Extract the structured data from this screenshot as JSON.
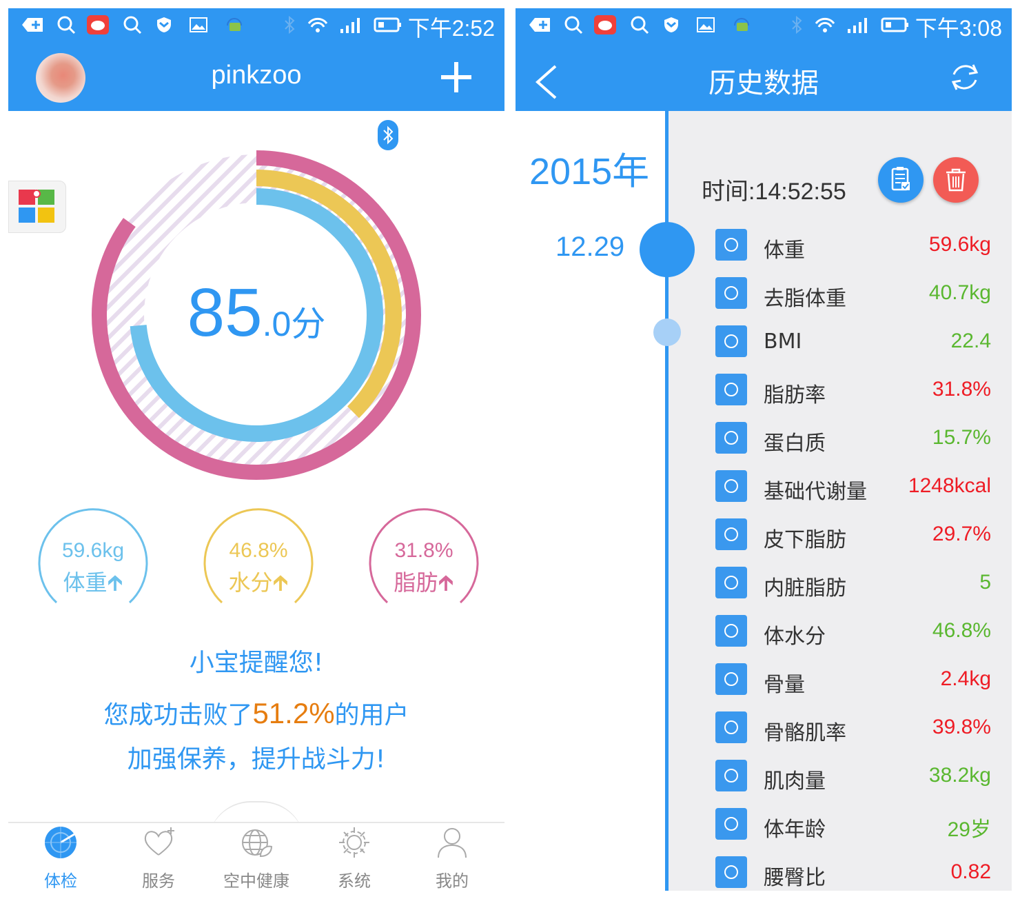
{
  "left": {
    "status_time": "下午2:52",
    "title": "pinkzoo",
    "score_int": "85",
    "score_dec": ".0分",
    "gauges": [
      {
        "value": "59.6kg",
        "label": "体重",
        "color": "#6cc1ec"
      },
      {
        "value": "46.8%",
        "label": "水分",
        "color": "#ecc755"
      },
      {
        "value": "31.8%",
        "label": "脂肪",
        "color": "#d6689a"
      }
    ],
    "reminder_title": "小宝提醒您!",
    "reminder_pre": "您成功击败了",
    "reminder_pct": "51.2%",
    "reminder_post": "的用户",
    "reminder_line2": "加强保养，提升战斗力!",
    "tabs": [
      {
        "label": "体检",
        "icon": "radar-icon"
      },
      {
        "label": "服务",
        "icon": "heart-plus-icon"
      },
      {
        "label": "空中健康",
        "icon": "globe-leaf-icon"
      },
      {
        "label": "系统",
        "icon": "gear-icon"
      },
      {
        "label": "我的",
        "icon": "user-icon"
      }
    ]
  },
  "right": {
    "status_time": "下午3:08",
    "title": "历史数据",
    "year": "2015年",
    "date": "12.29",
    "time_label": "时间:14:52:55",
    "metrics": [
      {
        "name": "体重",
        "value": "59.6kg",
        "status": "red",
        "icon": "weight-icon"
      },
      {
        "name": "去脂体重",
        "value": "40.7kg",
        "status": "green",
        "icon": "spine-icon"
      },
      {
        "name": "BMI",
        "value": "22.4",
        "status": "green",
        "icon": "ruler-icon"
      },
      {
        "name": "脂肪率",
        "value": "31.8%",
        "status": "red",
        "icon": "fat-layer-icon"
      },
      {
        "name": "蛋白质",
        "value": "15.7%",
        "status": "green",
        "icon": "dna-icon"
      },
      {
        "name": "基础代谢量",
        "value": "1248kcal",
        "status": "red",
        "icon": "recycle-icon"
      },
      {
        "name": "皮下脂肪",
        "value": "29.7%",
        "status": "red",
        "icon": "percent-icon"
      },
      {
        "name": "内脏脂肪",
        "value": "5",
        "status": "green",
        "icon": "organ-icon"
      },
      {
        "name": "体水分",
        "value": "46.8%",
        "status": "green",
        "icon": "water-drop-icon"
      },
      {
        "name": "骨量",
        "value": "2.4kg",
        "status": "red",
        "icon": "bone-icon"
      },
      {
        "name": "骨骼肌率",
        "value": "39.8%",
        "status": "red",
        "icon": "leg-bone-icon"
      },
      {
        "name": "肌肉量",
        "value": "38.2kg",
        "status": "green",
        "icon": "muscle-arm-icon"
      },
      {
        "name": "体年龄",
        "value": "29岁",
        "status": "green",
        "icon": "person-icon"
      },
      {
        "name": "腰臀比",
        "value": "0.82",
        "status": "red",
        "icon": "waist-icon"
      }
    ]
  }
}
